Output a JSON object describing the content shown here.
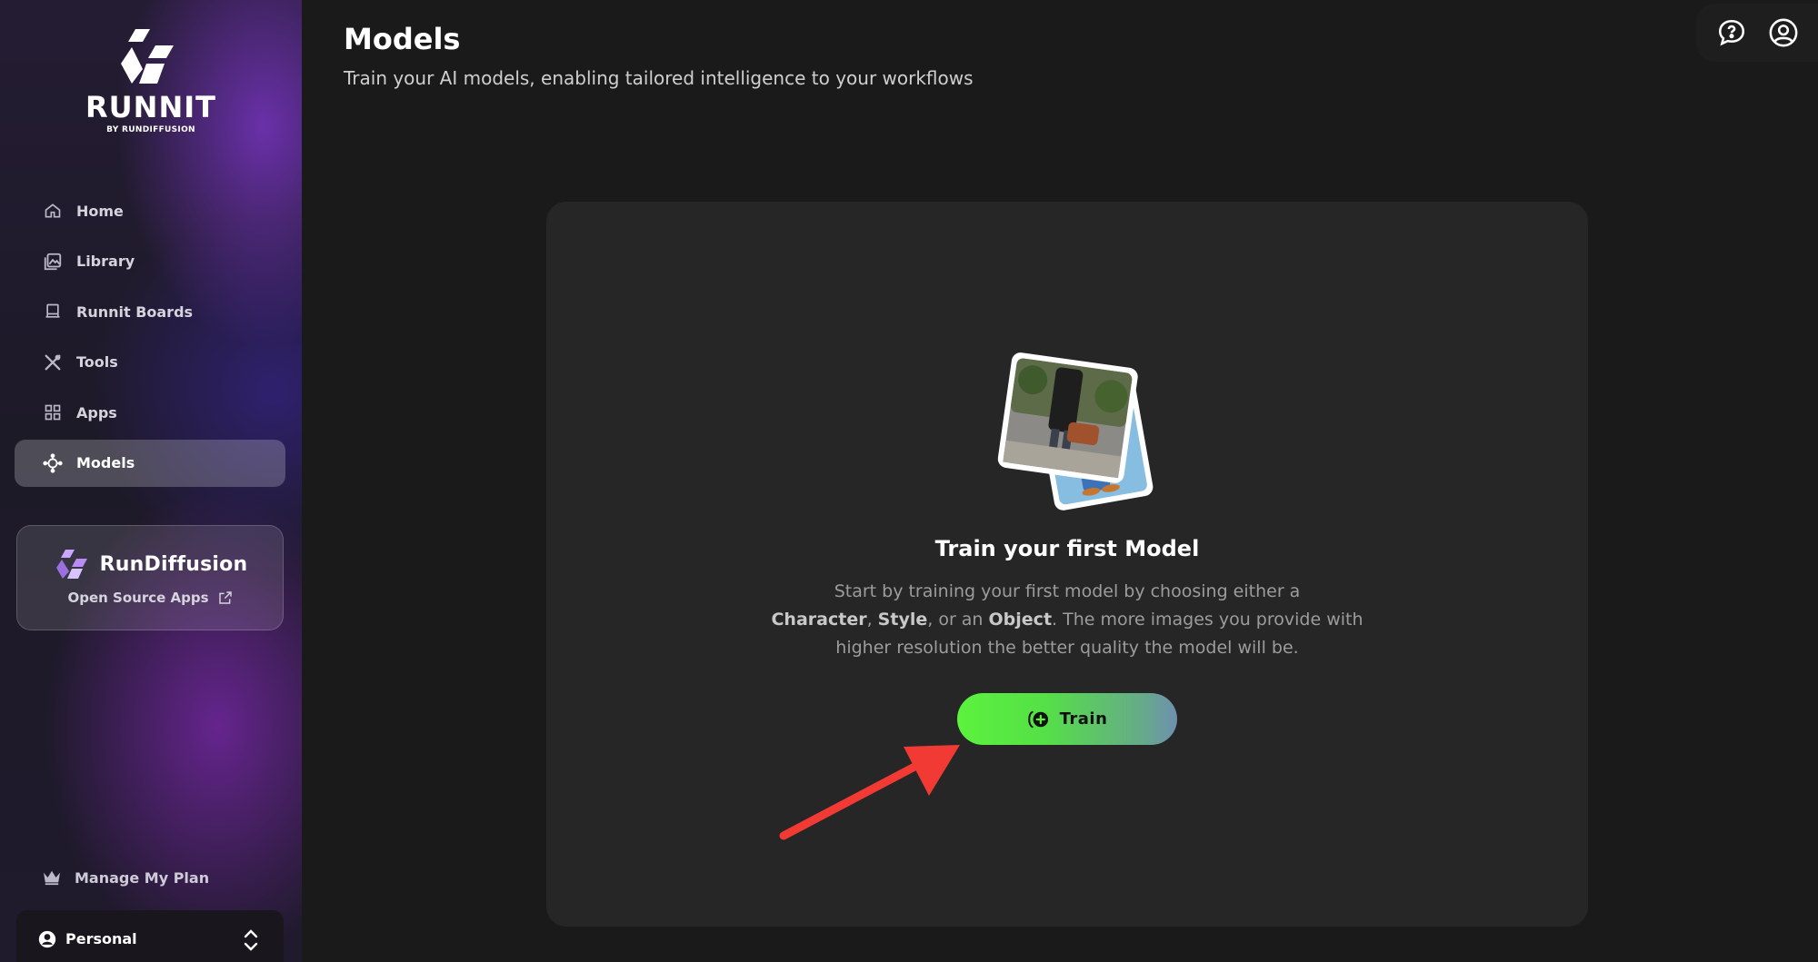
{
  "brand": {
    "name": "RUNNIT",
    "byline": "BY RUNDIFFUSION"
  },
  "sidebar": {
    "items": [
      {
        "label": "Home",
        "icon": "home-icon",
        "active": false
      },
      {
        "label": "Library",
        "icon": "library-icon",
        "active": false
      },
      {
        "label": "Runnit Boards",
        "icon": "boards-icon",
        "active": false
      },
      {
        "label": "Tools",
        "icon": "tools-icon",
        "active": false
      },
      {
        "label": "Apps",
        "icon": "apps-icon",
        "active": false
      },
      {
        "label": "Models",
        "icon": "models-icon",
        "active": true
      }
    ],
    "promo": {
      "title": "RunDiffusion",
      "link_label": "Open Source Apps"
    },
    "manage_plan_label": "Manage My Plan",
    "account": {
      "label": "Personal"
    }
  },
  "page": {
    "title": "Models",
    "subtitle": "Train your AI models, enabling tailored intelligence to your workflows"
  },
  "empty_state": {
    "title": "Train your first Model",
    "desc_part1": "Start by training your first model by choosing either a",
    "desc_character": "Character",
    "desc_sep1": ",",
    "desc_style": "Style",
    "desc_sep2": ", or an",
    "desc_object": "Object",
    "desc_part2": ". The more images you provide with higher resolution the better quality the model will be.",
    "button_label": "Train"
  },
  "colors": {
    "accent_green": "#5cf23e",
    "accent_blue": "#6f8fb0",
    "arrow_red": "#f03a33",
    "active_nav": "#4a4656"
  }
}
